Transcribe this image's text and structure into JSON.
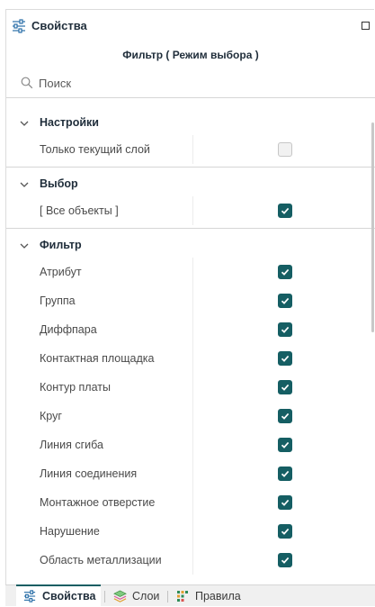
{
  "header": {
    "title": "Свойства",
    "icon": "sliders-icon"
  },
  "subtitle": "Фильтр ( Режим выбора )",
  "search": {
    "placeholder": "Поиск",
    "value": ""
  },
  "sections": [
    {
      "title": "Настройки",
      "expanded": true,
      "rows": [
        {
          "label": "Только текущий слой",
          "checked": false
        }
      ]
    },
    {
      "title": "Выбор",
      "expanded": true,
      "rows": [
        {
          "label": "[ Все объекты ]",
          "checked": true
        }
      ]
    },
    {
      "title": "Фильтр",
      "expanded": true,
      "rows": [
        {
          "label": "Атрибут",
          "checked": true
        },
        {
          "label": "Группа",
          "checked": true
        },
        {
          "label": "Диффпара",
          "checked": true
        },
        {
          "label": "Контактная площадка",
          "checked": true
        },
        {
          "label": "Контур платы",
          "checked": true
        },
        {
          "label": "Круг",
          "checked": true
        },
        {
          "label": "Линия сгиба",
          "checked": true
        },
        {
          "label": "Линия соединения",
          "checked": true
        },
        {
          "label": "Монтажное отверстие",
          "checked": true
        },
        {
          "label": "Нарушение",
          "checked": true
        },
        {
          "label": "Область металлизации",
          "checked": true
        }
      ]
    }
  ],
  "tabs": [
    {
      "label": "Свойства",
      "icon": "sliders-icon",
      "active": true
    },
    {
      "label": "Слои",
      "icon": "layers-icon",
      "active": false
    },
    {
      "label": "Правила",
      "icon": "rules-grid-icon",
      "active": false
    }
  ],
  "colors": {
    "accent": "#155e63",
    "checkbox_off": "#f1f1f1",
    "text": "#4a4a4a",
    "heading": "#1f2d3a"
  }
}
